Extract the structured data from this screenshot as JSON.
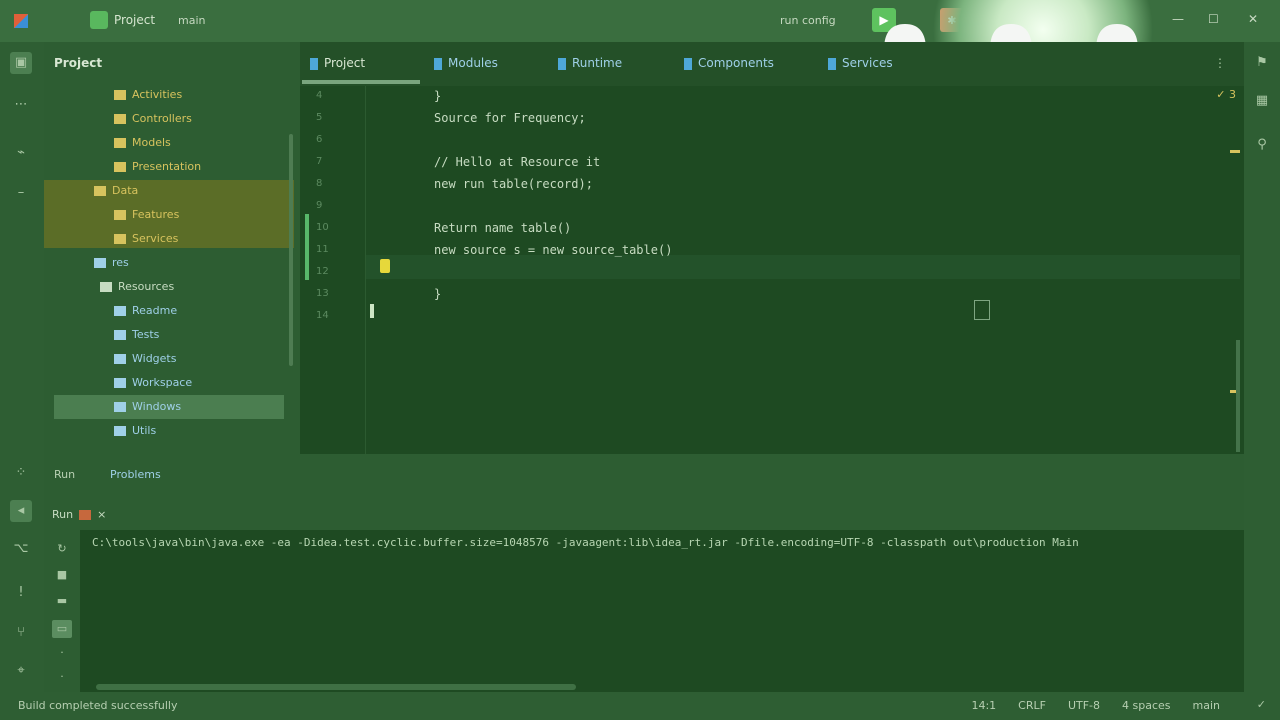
{
  "titlebar": {
    "project": "Project",
    "branch": "main",
    "run_config": "run config",
    "run_icon": "play-icon",
    "debug_icon": "bug-icon",
    "controls": [
      "—",
      "☐",
      "✕"
    ]
  },
  "project_panel": {
    "title": "Project",
    "tree": [
      {
        "label": "Activities",
        "color": "#d7c35e"
      },
      {
        "label": "Controllers",
        "color": "#d7c35e"
      },
      {
        "label": "Models",
        "color": "#d7c35e"
      },
      {
        "label": "Presentation",
        "color": "#d7c35e"
      },
      {
        "label": "Data",
        "color": "#d7c35e"
      },
      {
        "label": "Features",
        "color": "#d7c35e"
      },
      {
        "label": "Services",
        "color": "#d7c35e"
      },
      {
        "label": "res",
        "color": "#9fd0e8"
      },
      {
        "label": "Resources",
        "color": "#c7dcc2"
      },
      {
        "label": "Readme",
        "color": "#9fd0e8"
      },
      {
        "label": "Tests",
        "color": "#9fd0e8"
      },
      {
        "label": "Widgets",
        "color": "#9fd0e8"
      },
      {
        "label": "Workspace",
        "color": "#9fd0e8"
      },
      {
        "label": "Windows",
        "color": "#9fd0e8"
      },
      {
        "label": "Utils",
        "color": "#9fd0e8"
      }
    ]
  },
  "editor": {
    "tabs": [
      "Project",
      "Modules",
      "Runtime",
      "Components",
      "Services"
    ],
    "inspect": "✓ 3",
    "line_numbers": [
      "4",
      "5",
      "6",
      "7",
      "8",
      "9",
      "10",
      "11",
      "12",
      "13",
      "14"
    ],
    "code": [
      "}",
      "Source for Frequency;",
      "",
      "// Hello at Resource it",
      "new run table(record);",
      "",
      "Return name table()",
      "new source s = new source_table()",
      "",
      "}",
      ""
    ]
  },
  "breadcrumb": {
    "left": "Run",
    "right": "Problems"
  },
  "run_panel": {
    "tab_label": "Run"
  },
  "console": {
    "line": "C:\\tools\\java\\bin\\java.exe -ea -Didea.test.cyclic.buffer.size=1048576 -javaagent:lib\\idea_rt.jar -Dfile.encoding=UTF-8 -classpath out\\production Main"
  },
  "statusbar": {
    "left": "Build completed successfully",
    "position": "14:1",
    "line_sep": "CRLF",
    "encoding": "UTF-8",
    "indent": "4 spaces",
    "vcs": "main"
  },
  "colors": {
    "bg": "#1e4a22",
    "panel": "#2d5d32",
    "accent": "#58b86a",
    "warning": "#d7c35e"
  }
}
